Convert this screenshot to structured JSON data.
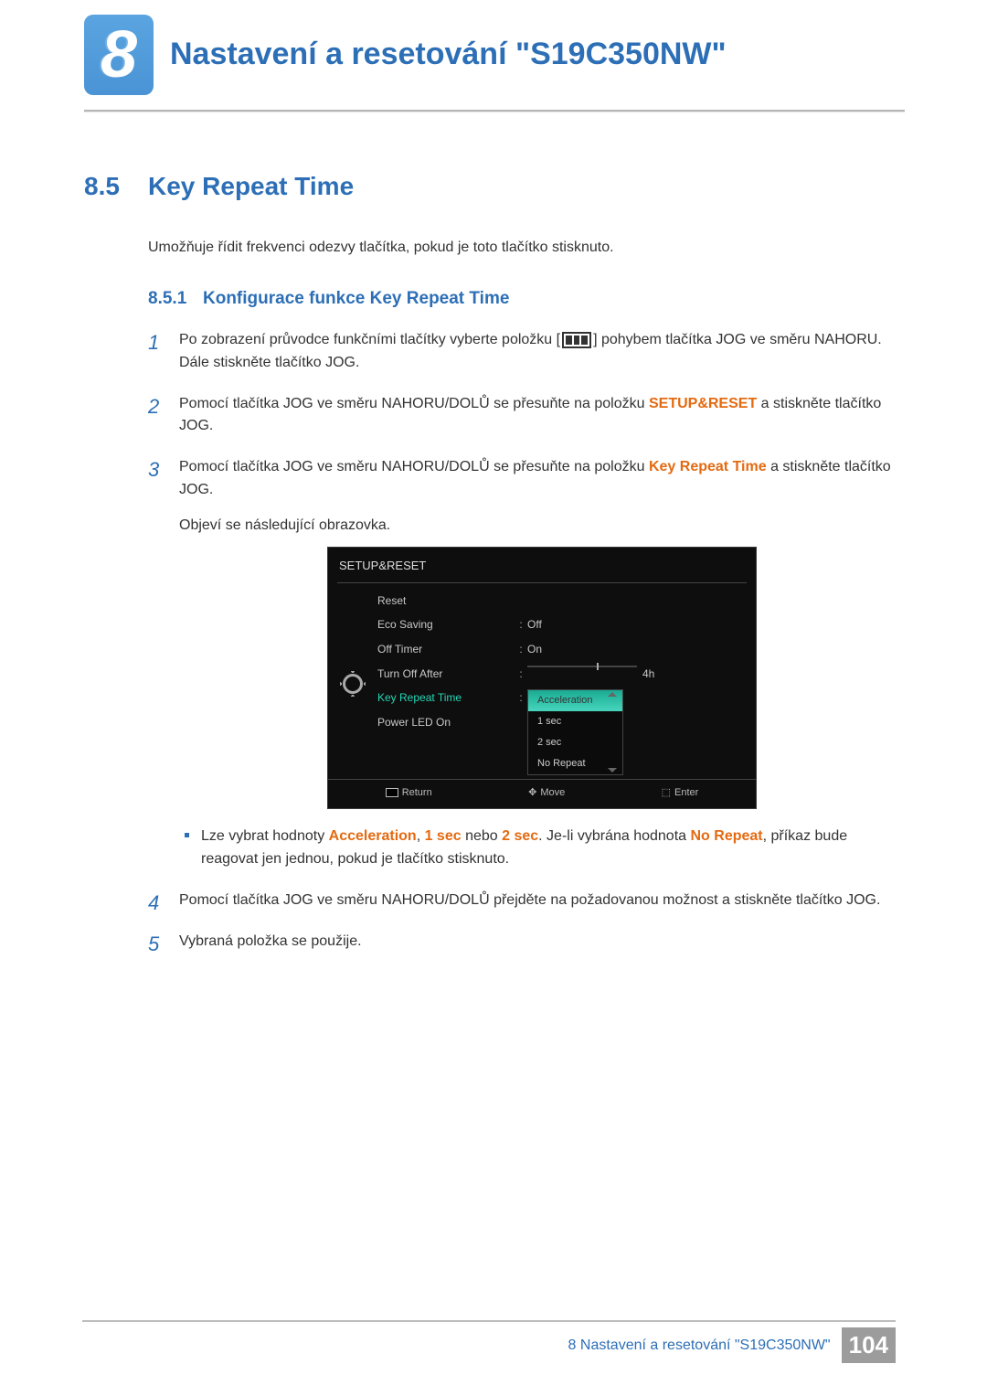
{
  "chapter": {
    "number": "8",
    "title": "Nastavení a resetování \"S19C350NW\""
  },
  "section": {
    "number": "8.5",
    "title": "Key Repeat Time"
  },
  "intro": "Umožňuje řídit frekvenci odezvy tlačítka, pokud je toto tlačítko stisknuto.",
  "subsection": {
    "number": "8.5.1",
    "title": "Konfigurace funkce Key Repeat Time"
  },
  "steps": {
    "s1a": "Po zobrazení průvodce funkčními tlačítky vyberte položku [",
    "s1b": "] pohybem tlačítka JOG ve směru NAHORU. Dále stiskněte tlačítko JOG.",
    "s2a": "Pomocí tlačítka JOG ve směru NAHORU/DOLŮ se přesuňte na položku ",
    "s2b": " a stiskněte tlačítko JOG.",
    "s2_hi": "SETUP&RESET",
    "s3a": "Pomocí tlačítka JOG ve směru NAHORU/DOLŮ se přesuňte na položku ",
    "s3_hi": "Key Repeat Time",
    "s3b": " a stiskněte tlačítko JOG.",
    "s3_after": "Objeví se následující obrazovka.",
    "bullet_a": "Lze vybrat hodnoty ",
    "bullet_b": ", ",
    "bullet_c": " nebo ",
    "bullet_d": ". Je-li vybrána hodnota ",
    "bullet_e": ", příkaz bude reagovat jen jednou, pokud je tlačítko stisknuto.",
    "hi_accel": "Acceleration",
    "hi_1sec": "1 sec",
    "hi_2sec": "2 sec",
    "hi_norepeat": "No Repeat",
    "s4": "Pomocí tlačítka JOG ve směru NAHORU/DOLŮ přejděte na požadovanou možnost a stiskněte tlačítko JOG.",
    "s5": "Vybraná položka se použije."
  },
  "osd": {
    "title": "SETUP&RESET",
    "rows": {
      "reset": "Reset",
      "eco": "Eco Saving",
      "eco_val": "Off",
      "timer": "Off Timer",
      "timer_val": "On",
      "turnoff": "Turn Off After",
      "turnoff_val": "4h",
      "krt": "Key Repeat Time",
      "led": "Power LED On"
    },
    "options": {
      "o1": "Acceleration",
      "o2": "1 sec",
      "o3": "2 sec",
      "o4": "No Repeat"
    },
    "footer": {
      "return": "Return",
      "move": "Move",
      "enter": "Enter"
    }
  },
  "footer": {
    "text": "8 Nastavení a resetování \"S19C350NW\"",
    "page": "104"
  }
}
